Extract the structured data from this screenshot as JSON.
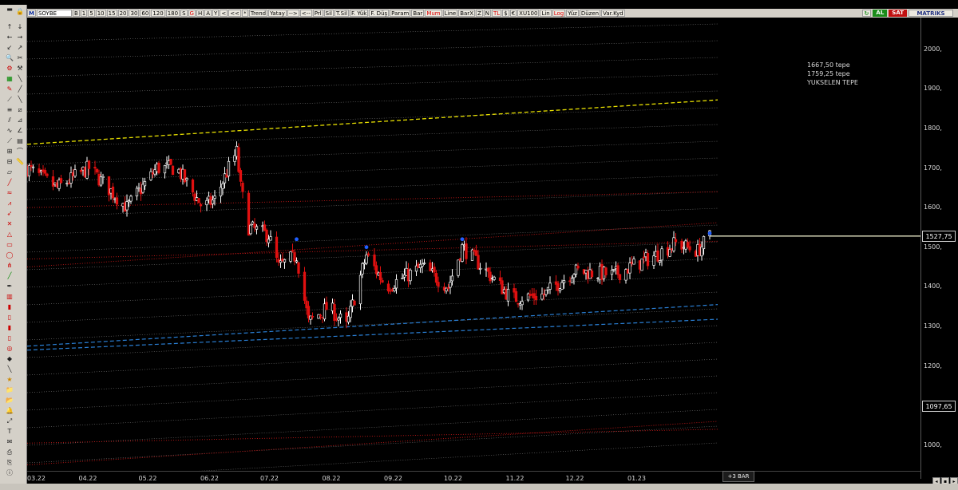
{
  "toolbar": {
    "logo": "M",
    "symbol": "SOYBE",
    "period": "B",
    "intervals": [
      "1",
      "5",
      "10",
      "15",
      "20",
      "30",
      "60",
      "120",
      "180"
    ],
    "s_label": "S",
    "gun_label": "GUN",
    "tl_label": "TL",
    "log_label": "LOG",
    "khn_label": "KHN",
    "svd_label": "SVD",
    "tmp_label": "TMP",
    "btn_g": "G",
    "btn_h": "H",
    "btn_a": "A",
    "btn_y": "Y",
    "btn_lt": "<",
    "btn_ltlt": "<<",
    "btn_star": "*",
    "trend": "Trend",
    "yatay": "Yatay",
    "arrow_right": "-->",
    "arrow_left": "<--",
    "prl": "Prl",
    "sil": "Sil",
    "tsil": "T.Sil",
    "fyuk": "F. Yük",
    "fdus": "F. Düş",
    "param": "Param",
    "bar": "Bar",
    "mum": "Mum",
    "line": "Line",
    "barx": "BarX",
    "z": "Z",
    "n": "N",
    "tl2": "TL",
    "dollar": "$",
    "euro": "€",
    "xu100": "XU100",
    "lin": "Lin",
    "logb": "Log",
    "yuz": "Yüz",
    "duzen": "Düzen",
    "varkyd": "Var.Kyd"
  },
  "right_buttons": {
    "al": "AL",
    "sat": "SAT",
    "matriks": "MATRIKS"
  },
  "chart_data": {
    "type": "candlestick",
    "symbol": "SOYBE",
    "ylim": [
      935,
      2080
    ],
    "y_ticks": [
      1000,
      1200,
      1300,
      1400,
      1500,
      1600,
      1700,
      1800,
      1900,
      2000
    ],
    "x_labels": [
      "03.22",
      "04.22",
      "05.22",
      "06.22",
      "07.22",
      "08.22",
      "09.22",
      "10.22",
      "11.22",
      "12.22",
      "01.23"
    ],
    "x_range": [
      "2022-03-01",
      "2023-02-10"
    ],
    "last_price": "1527,75",
    "crosshair_price": "1097,65",
    "annotation_lines": [
      "1667,50 tepe",
      "1759,25 tepe",
      "YUKSELEN TEPE"
    ],
    "anchors": [
      {
        "date": "2022-03-01",
        "close": 1700
      },
      {
        "date": "2022-03-16",
        "close": 1650
      },
      {
        "date": "2022-04-01",
        "close": 1700
      },
      {
        "date": "2022-04-20",
        "close": 1600
      },
      {
        "date": "2022-05-05",
        "close": 1700
      },
      {
        "date": "2022-05-15",
        "close": 1700
      },
      {
        "date": "2022-05-28",
        "close": 1600
      },
      {
        "date": "2022-06-03",
        "close": 1620
      },
      {
        "date": "2022-06-10",
        "close": 1700
      },
      {
        "date": "2022-06-14",
        "close": 1740
      },
      {
        "date": "2022-06-16",
        "close": 1650
      },
      {
        "date": "2022-06-20",
        "close": 1550
      },
      {
        "date": "2022-06-30",
        "close": 1530
      },
      {
        "date": "2022-07-05",
        "close": 1450
      },
      {
        "date": "2022-07-14",
        "close": 1480
      },
      {
        "date": "2022-07-20",
        "close": 1310
      },
      {
        "date": "2022-07-30",
        "close": 1350
      },
      {
        "date": "2022-08-08",
        "close": 1300
      },
      {
        "date": "2022-08-18",
        "close": 1480
      },
      {
        "date": "2022-08-28",
        "close": 1400
      },
      {
        "date": "2022-09-15",
        "close": 1450
      },
      {
        "date": "2022-09-28",
        "close": 1400
      },
      {
        "date": "2022-10-05",
        "close": 1500
      },
      {
        "date": "2022-10-15",
        "close": 1450
      },
      {
        "date": "2022-10-30",
        "close": 1370
      },
      {
        "date": "2022-11-15",
        "close": 1380
      },
      {
        "date": "2022-11-30",
        "close": 1440
      },
      {
        "date": "2022-12-20",
        "close": 1430
      },
      {
        "date": "2023-01-10",
        "close": 1480
      },
      {
        "date": "2023-01-20",
        "close": 1510
      },
      {
        "date": "2023-01-31",
        "close": 1490
      },
      {
        "date": "2023-02-06",
        "close": 1528
      }
    ],
    "peak_markers": [
      {
        "date": "2022-07-14",
        "price": 1520
      },
      {
        "date": "2022-08-18",
        "price": 1500
      },
      {
        "date": "2022-10-05",
        "price": 1520
      },
      {
        "date": "2023-02-06",
        "price": 1535
      }
    ],
    "overlay_lines": [
      {
        "style": "yellow-dashed",
        "from": {
          "date": "2022-03-01",
          "price": 1760
        },
        "to": {
          "date": "2023-02-10",
          "price": 1872
        }
      },
      {
        "style": "blue-dashed",
        "from": {
          "date": "2022-03-01",
          "price": 1250
        },
        "to": {
          "date": "2023-02-10",
          "price": 1355
        }
      },
      {
        "style": "blue-dashed",
        "from": {
          "date": "2022-03-01",
          "price": 1240
        },
        "to": {
          "date": "2023-02-10",
          "price": 1318
        }
      },
      {
        "style": "red-dotted",
        "from": {
          "date": "2022-03-01",
          "price": 1450
        },
        "to": {
          "date": "2023-02-10",
          "price": 1562
        }
      },
      {
        "style": "red-dotted",
        "from": {
          "date": "2022-03-01",
          "price": 1470
        },
        "to": {
          "date": "2023-02-10",
          "price": 1515
        }
      },
      {
        "style": "red-dotted",
        "from": {
          "date": "2022-03-01",
          "price": 1600
        },
        "to": {
          "date": "2023-02-10",
          "price": 1640
        }
      },
      {
        "style": "red-dotted",
        "from": {
          "date": "2022-03-01",
          "price": 950
        },
        "to": {
          "date": "2023-02-10",
          "price": 1060
        }
      },
      {
        "style": "red-dotted",
        "from": {
          "date": "2022-03-01",
          "price": 1005
        },
        "to": {
          "date": "2023-02-10",
          "price": 1040
        }
      }
    ],
    "last_price_line": {
      "price": 1528,
      "from": "2023-02-06"
    }
  },
  "time_axis": {
    "plus_bars": "+3 BAR"
  },
  "colors": {
    "up": "#ffffff",
    "down": "#e01010",
    "bg": "#000000",
    "accent": "#2060ff",
    "yellow": "#e8e000"
  }
}
